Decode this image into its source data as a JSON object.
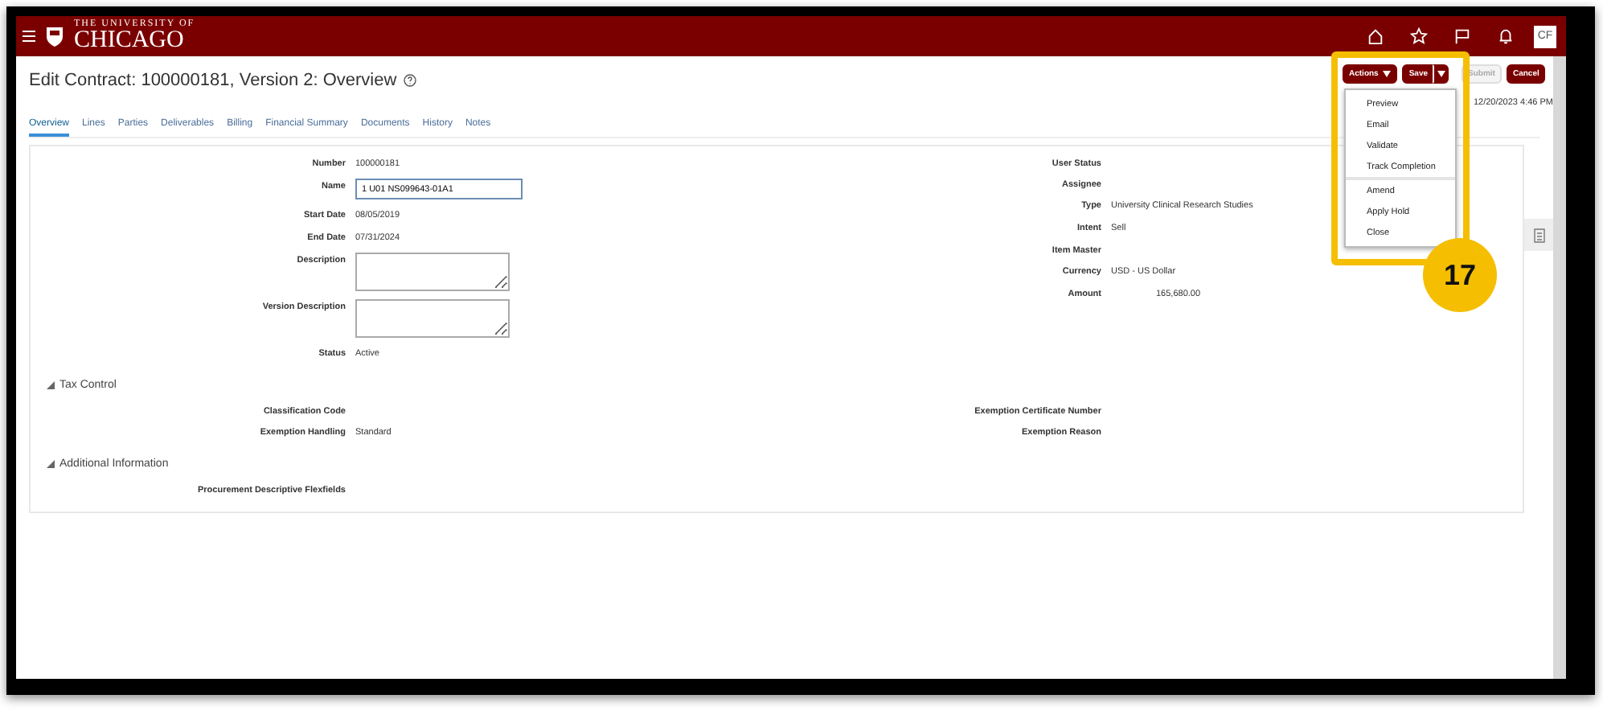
{
  "header": {
    "logo_top": "THE UNIVERSITY OF",
    "logo_name": "CHICAGO",
    "avatar": "CF"
  },
  "page_title": "Edit Contract: 100000181, Version 2: Overview",
  "tabs": [
    {
      "label": "Overview",
      "selected": true
    },
    {
      "label": "Lines",
      "selected": false
    },
    {
      "label": "Parties",
      "selected": false
    },
    {
      "label": "Deliverables",
      "selected": false
    },
    {
      "label": "Billing",
      "selected": false
    },
    {
      "label": "Financial Summary",
      "selected": false
    },
    {
      "label": "Documents",
      "selected": false
    },
    {
      "label": "History",
      "selected": false
    },
    {
      "label": "Notes",
      "selected": false
    }
  ],
  "toolbar": [
    {
      "label": "Actions",
      "kind": "menu"
    },
    {
      "label": "Save",
      "kind": "split"
    },
    {
      "label": "Submit",
      "kind": "plain",
      "disabled": true
    },
    {
      "label": "Cancel",
      "kind": "plain",
      "disabled": false
    }
  ],
  "last_saved": "12/20/2023 4:46 PM",
  "actions_menu": [
    {
      "label": "Preview",
      "group_start": false
    },
    {
      "label": "Email",
      "group_start": false
    },
    {
      "label": "Validate",
      "group_start": false
    },
    {
      "label": "Track Completion",
      "group_start": false
    },
    {
      "label": "Amend",
      "group_start": true
    },
    {
      "label": "Apply Hold",
      "group_start": false
    },
    {
      "label": "Close",
      "group_start": false
    }
  ],
  "callout": "17",
  "overview_left": [
    {
      "label": "Number",
      "value": "100000181",
      "kind": "text"
    },
    {
      "label": "Name",
      "value": "1 U01 NS099643-01A1",
      "kind": "input"
    },
    {
      "label": "Start Date",
      "value": "08/05/2019",
      "kind": "text"
    },
    {
      "label": "End Date",
      "value": "07/31/2024",
      "kind": "text"
    },
    {
      "label": "Description",
      "kind": "textarea"
    },
    {
      "label": "Version Description",
      "kind": "textarea"
    },
    {
      "label": "Status",
      "value": "Active",
      "kind": "text"
    }
  ],
  "overview_right": [
    {
      "label": "User Status",
      "kind": "text"
    },
    {
      "label": "Assignee",
      "kind": "text"
    },
    {
      "label": "Type",
      "value": "University Clinical Research Studies",
      "kind": "text"
    },
    {
      "label": "Intent",
      "value": "Sell",
      "kind": "text"
    },
    {
      "label": "Item Master",
      "kind": "text"
    },
    {
      "label": "Currency",
      "value": "USD - US Dollar",
      "kind": "text"
    },
    {
      "label": "Amount",
      "value": "165,680.00",
      "kind": "amount"
    }
  ],
  "sections": [
    {
      "title": "Tax Control",
      "expanded": true,
      "left": [
        {
          "label": "Classification Code"
        },
        {
          "label": "Exemption Handling",
          "value": "Standard"
        }
      ],
      "right": [
        {
          "label": "Exemption Certificate Number"
        },
        {
          "label": "Exemption Reason"
        }
      ]
    },
    {
      "title": "Additional Information",
      "expanded": true,
      "left": [
        {
          "label": "Procurement Descriptive Flexfields"
        }
      ]
    }
  ]
}
